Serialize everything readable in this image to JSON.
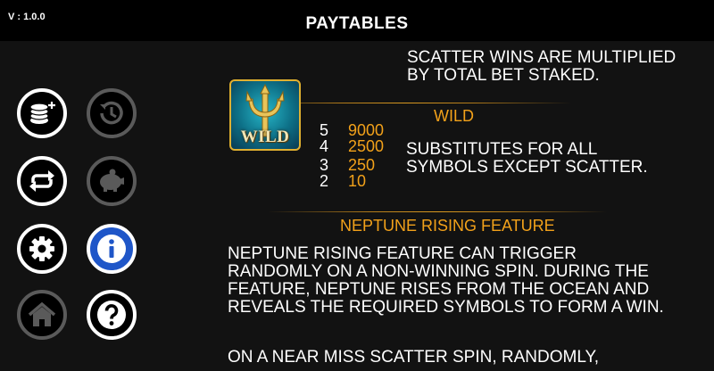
{
  "header": {
    "version": "V : 1.0.0",
    "title": "PAYTABLES"
  },
  "sidebar": {
    "buttons": [
      {
        "name": "bet-button",
        "icon": "coins-plus-icon",
        "state": "normal"
      },
      {
        "name": "history-button",
        "icon": "history-icon",
        "state": "dim"
      },
      {
        "name": "autoplay-button",
        "icon": "repeat-icon",
        "state": "normal"
      },
      {
        "name": "bank-button",
        "icon": "piggy-bank-icon",
        "state": "dim"
      },
      {
        "name": "settings-button",
        "icon": "gear-icon",
        "state": "normal"
      },
      {
        "name": "info-button",
        "icon": "info-icon",
        "state": "active"
      },
      {
        "name": "home-button",
        "icon": "home-icon",
        "state": "dim"
      },
      {
        "name": "help-button",
        "icon": "question-icon",
        "state": "normal"
      }
    ]
  },
  "scatter": {
    "line1": "SCATTER WINS ARE MULTIPLIED",
    "line2": "BY TOTAL BET STAKED."
  },
  "wild": {
    "title": "WILD",
    "symbol_label": "WILD",
    "pays": [
      {
        "count": "5",
        "amount": "9000"
      },
      {
        "count": "4",
        "amount": "2500"
      },
      {
        "count": "3",
        "amount": "250"
      },
      {
        "count": "2",
        "amount": "10"
      }
    ],
    "description_line1": "SUBSTITUTES FOR ALL",
    "description_line2": "SYMBOLS EXCEPT SCATTER."
  },
  "feature": {
    "title": "NEPTUNE RISING FEATURE",
    "para1": [
      "NEPTUNE RISING FEATURE CAN TRIGGER",
      "RANDOMLY ON A NON-WINNING SPIN. DURING THE",
      "FEATURE, NEPTUNE RISES FROM THE OCEAN AND",
      "REVEALS THE REQUIRED SYMBOLS TO FORM A WIN."
    ],
    "para2_line1": "ON A NEAR MISS SCATTER SPIN, RANDOMLY,"
  },
  "colors": {
    "accent_gold": "#f2a11a",
    "active_blue": "#1f56c8",
    "background": "#121212"
  }
}
